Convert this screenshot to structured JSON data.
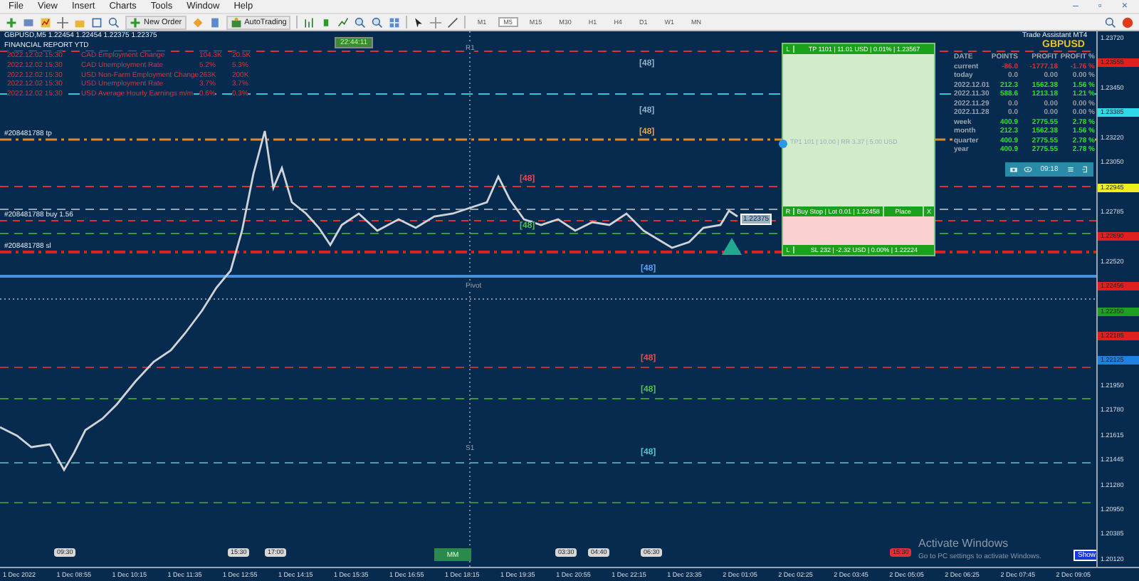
{
  "menu": [
    "File",
    "View",
    "Insert",
    "Charts",
    "Tools",
    "Window",
    "Help"
  ],
  "window_controls": [
    "–",
    "▫",
    "×"
  ],
  "toolbar": {
    "new_order": "New Order",
    "auto_trading": "AutoTrading",
    "timeframes": [
      {
        "label": "M1",
        "selected": false
      },
      {
        "label": "M5",
        "selected": true
      },
      {
        "label": "M15",
        "selected": false
      },
      {
        "label": "M30",
        "selected": false
      },
      {
        "label": "H1",
        "selected": false
      },
      {
        "label": "H4",
        "selected": false
      },
      {
        "label": "D1",
        "selected": false
      },
      {
        "label": "W1",
        "selected": false
      },
      {
        "label": "MN",
        "selected": false
      }
    ]
  },
  "chart": {
    "symbol_line": "GBPUSD,M5  1.22454 1.22454 1.22375 1.22375",
    "report_title": "FINANCIAL REPORT YTD",
    "clock": "22:44:11",
    "news": [
      {
        "time": "2022.12.02 15:30",
        "currency": "CAD",
        "event": "Employment Change",
        "actual": "104.3K",
        "forecast": "20.5K"
      },
      {
        "time": "2022.12.02 15:30",
        "currency": "CAD",
        "event": "Unemployment Rate",
        "actual": "5.2%",
        "forecast": "5.3%"
      },
      {
        "time": "2022.12.02 15:30",
        "currency": "USD",
        "event": "Non-Farm Employment Change",
        "actual": "263K",
        "forecast": "200K"
      },
      {
        "time": "2022.12.02 15:30",
        "currency": "USD",
        "event": "Unemployment Rate",
        "actual": "3.7%",
        "forecast": "3.7%"
      },
      {
        "time": "2022.12.02 15:30",
        "currency": "USD",
        "event": "Average Hourly Earnings m/m",
        "actual": "0.6%",
        "forecast": "0.3%"
      }
    ],
    "pivots": [
      "R1",
      "Pivot",
      "S1"
    ],
    "order_labels": [
      "#208481788 tp",
      "#208481788 buy 1.56",
      "#208481788 sl"
    ],
    "level_labels": [
      {
        "text": "[48]",
        "color": "#8fb0c8"
      },
      {
        "text": "[48]",
        "color": "#8fb0c8"
      },
      {
        "text": "[48]",
        "color": "#f0a040"
      },
      {
        "text": "[48]",
        "color": "#f04848"
      },
      {
        "text": "[48]",
        "color": "#50c050"
      },
      {
        "text": "[48]",
        "color": "#5aa0f0"
      },
      {
        "text": "[48]",
        "color": "#f04848"
      },
      {
        "text": "[48]",
        "color": "#50c050"
      },
      {
        "text": "[48]",
        "color": "#50c8c8"
      }
    ],
    "price_tag": "1.22375",
    "trade": {
      "tp_side": "L",
      "tp": "TP 1101 | 11.01 USD | 0.01% | 1.23567",
      "entry": "TP1 101 | 10.00 | RR 3.37 | 5.00 USD",
      "r": "R",
      "order": "Buy Stop | Lot 0.01 | 1.22458",
      "place": "Place",
      "close": "X",
      "sl_side": "L",
      "sl": "SL 232 | -2.32 USD | 0.00% | 1.22224"
    },
    "assistant": {
      "title": "Trade Assistant MT4",
      "symbol": "GBPUSD",
      "columns": [
        "DATE",
        "POINTS",
        "PROFIT",
        "PROFIT %"
      ],
      "rows": [
        {
          "date": "current",
          "points": "-86.0",
          "profit": "-1777.18",
          "pct": "-1.76 %",
          "color": "#e03030"
        },
        {
          "date": "today",
          "points": "0.0",
          "profit": "0.00",
          "pct": "0.00 %",
          "color": "#9a9a9a"
        },
        {
          "date": "2022.12.01",
          "points": "212.3",
          "profit": "1562.38",
          "pct": "1.56 %",
          "color": "#30e030"
        },
        {
          "date": "2022.11.30",
          "points": "588.6",
          "profit": "1213.18",
          "pct": "1.21 %",
          "color": "#30e030"
        },
        {
          "date": "2022.11.29",
          "points": "0.0",
          "profit": "0.00",
          "pct": "0.00 %",
          "color": "#9a9a9a"
        },
        {
          "date": "2022.11.28",
          "points": "0.0",
          "profit": "0.00",
          "pct": "0.00 %",
          "color": "#9a9a9a"
        },
        {
          "date": "week",
          "points": "400.9",
          "profit": "2775.55",
          "pct": "2.78 %",
          "color": "#30e030"
        },
        {
          "date": "month",
          "points": "212.3",
          "profit": "1562.38",
          "pct": "1.56 %",
          "color": "#30e030"
        },
        {
          "date": "quarter",
          "points": "400.9",
          "profit": "2775.55",
          "pct": "2.78 %",
          "color": "#30e030"
        },
        {
          "date": "year",
          "points": "400.9",
          "profit": "2775.55",
          "pct": "2.78 %",
          "color": "#30e030"
        }
      ],
      "timer": "09:18"
    },
    "mm_button": "MM",
    "event_tags": [
      {
        "text": "09:30",
        "color": "#d8d8d8"
      },
      {
        "text": "15:30",
        "color": "#d8d8d8"
      },
      {
        "text": "17:00",
        "color": "#d8d8d8"
      },
      {
        "text": "03:30",
        "color": "#d8d8d8"
      },
      {
        "text": "04:40",
        "color": "#d8d8d8"
      },
      {
        "text": "06:30",
        "color": "#d8d8d8"
      },
      {
        "text": "15:30",
        "color": "#e0303a"
      }
    ],
    "activation": {
      "title": "Activate Windows",
      "hint": "Go to PC settings to activate Windows."
    },
    "show_button": "Show"
  },
  "price_axis": [
    {
      "text": "1.23720"
    },
    {
      "text": "1.23555",
      "color": "#e02020"
    },
    {
      "text": "1.23450"
    },
    {
      "text": "1.23385",
      "color": "#30d8e8"
    },
    {
      "text": "1.23220"
    },
    {
      "text": "1.23050"
    },
    {
      "text": "1.22945",
      "color": "#f0f020"
    },
    {
      "text": "1.22785"
    },
    {
      "text": "1.22690",
      "color": "#e02020"
    },
    {
      "text": "1.22520"
    },
    {
      "text": "1.22456",
      "color": "#e02020"
    },
    {
      "text": "1.22350",
      "color": "#20a020"
    },
    {
      "text": "1.22185",
      "color": "#e02020"
    },
    {
      "text": "1.22125",
      "color": "#2080e0"
    },
    {
      "text": "1.21950"
    },
    {
      "text": "1.21780"
    },
    {
      "text": "1.21615"
    },
    {
      "text": "1.21445"
    },
    {
      "text": "1.21280"
    },
    {
      "text": "1.20950"
    },
    {
      "text": "1.20385"
    },
    {
      "text": "1.20120"
    }
  ],
  "time_axis": [
    "1 Dec 2022",
    "1 Dec 08:55",
    "1 Dec 10:15",
    "1 Dec 11:35",
    "1 Dec 12:55",
    "1 Dec 14:15",
    "1 Dec 15:35",
    "1 Dec 16:55",
    "1 Dec 18:15",
    "1 Dec 19:35",
    "1 Dec 20:55",
    "1 Dec 22:15",
    "1 Dec 23:35",
    "2 Dec 01:05",
    "2 Dec 02:25",
    "2 Dec 03:45",
    "2 Dec 05:05",
    "2 Dec 06:25",
    "2 Dec 07:45",
    "2 Dec 09:05"
  ]
}
